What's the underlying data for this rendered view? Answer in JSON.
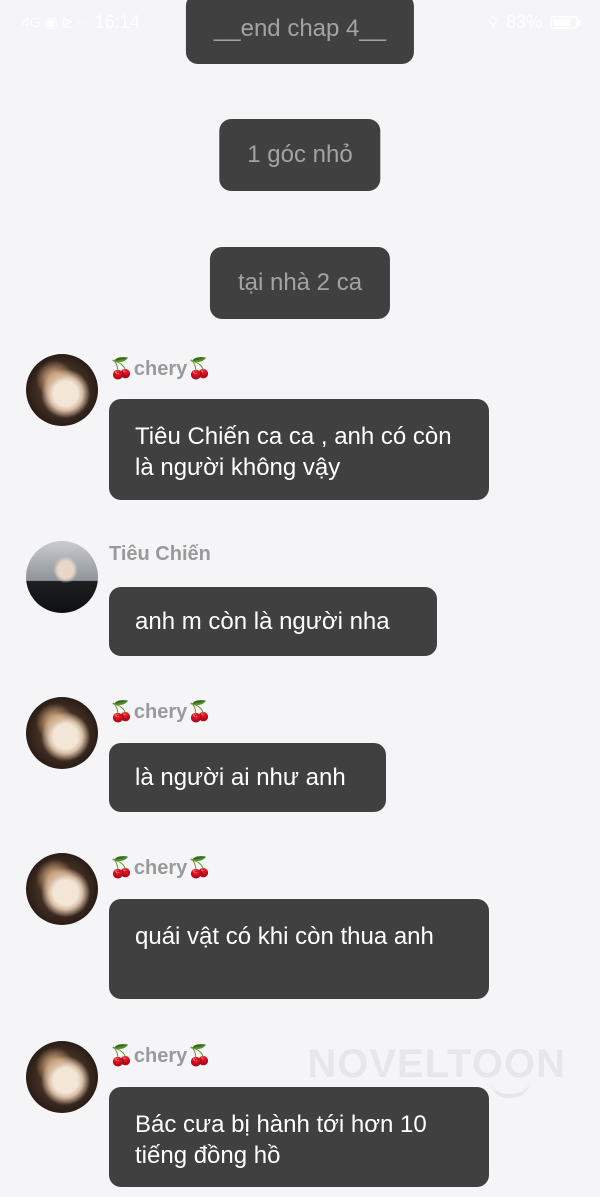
{
  "status_bar": {
    "time": "16:14",
    "left_icons": "4G ▣ ⊵ ··",
    "battery_level": 0.83,
    "battery_text": "83%",
    "right_icons": "⚲"
  },
  "narration": [
    {
      "text": "__end chap 4__"
    },
    {
      "text": "1 góc nhỏ"
    },
    {
      "text": "tại nhà 2 ca"
    }
  ],
  "messages": [
    {
      "sender": "🍒chery🍒",
      "avatar": "fluffy-cat-avatar",
      "text": "Tiêu Chiến ca ca , anh có còn là người không vậy"
    },
    {
      "sender": "Tiêu Chiến",
      "avatar": "man-portrait-avatar",
      "text": "anh m còn là người nha"
    },
    {
      "sender": "🍒chery🍒",
      "avatar": "fluffy-cat-avatar",
      "text": "là người ai như anh"
    },
    {
      "sender": "🍒chery🍒",
      "avatar": "fluffy-cat-avatar",
      "text": "quái vật có khi còn thua anh"
    },
    {
      "sender": "🍒chery🍒",
      "avatar": "fluffy-cat-avatar",
      "text": "Bác cưa bị hành tới hơn 10 tiếng đồng hồ"
    }
  ],
  "watermark": "NOVELTOON",
  "colors": {
    "background": "#f5f5f7",
    "bubble": "#404040",
    "bubble_text": "#ffffff",
    "narration_text": "#a3a3a3",
    "sender_name": "#9a9a9a"
  }
}
